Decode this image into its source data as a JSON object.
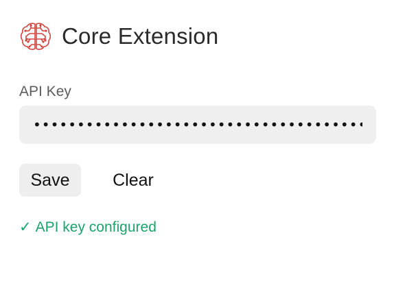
{
  "app": {
    "title": "Core Extension",
    "logo_icon": "brain-icon",
    "logo_color": "#d0453f"
  },
  "api_key": {
    "label": "API Key",
    "value": "••••••••••••••••••••••••••••••••••••••",
    "placeholder": ""
  },
  "actions": {
    "save_label": "Save",
    "clear_label": "Clear"
  },
  "status": {
    "icon": "check-icon",
    "check_glyph": "✓",
    "text": "API key configured",
    "color": "#1aa36b"
  }
}
